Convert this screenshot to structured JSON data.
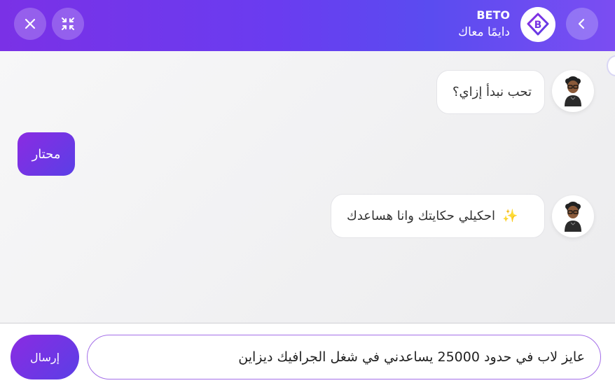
{
  "header": {
    "brand_name": "BETO",
    "tagline": "دايمًا معاك",
    "icons": {
      "close": "close-icon",
      "minimize": "minimize-icon",
      "back": "chevron-left-icon",
      "logo": "beto-logo-icon"
    },
    "gradient": [
      "#7a31e6",
      "#5a4cf0"
    ]
  },
  "messages": [
    {
      "from": "bot",
      "text": "تحب نبدأ إزاي؟"
    },
    {
      "from": "user",
      "text": "محتار"
    },
    {
      "from": "bot",
      "emoji": "✨",
      "text": "احكيلي حكايتك وانا هساعدك"
    }
  ],
  "composer": {
    "input_value": "عايز لاب في حدود 25000 يساعدني في شغل الجرافيك ديزاين",
    "send_label": "إرسال"
  },
  "colors": {
    "accent": "#8a2be2",
    "accent_end": "#5b3fe6",
    "bubble_bg": "#ffffff"
  }
}
